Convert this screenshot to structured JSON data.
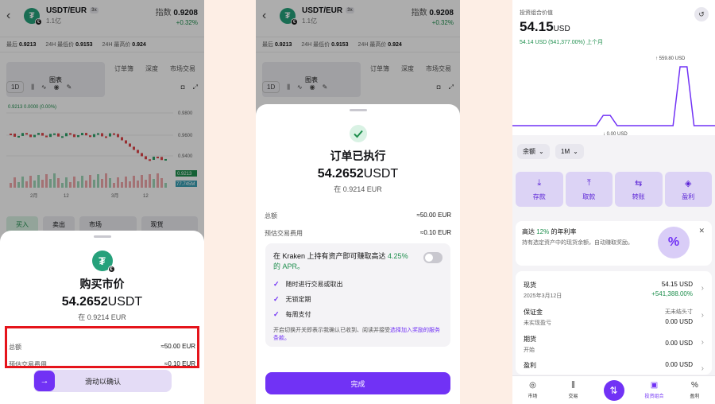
{
  "left": {
    "header": {
      "back": "‹",
      "coin_glyph": "₮",
      "pair": "USDT/EUR",
      "lev": "3x",
      "sub": "1.1亿",
      "index_label": "指数",
      "index_value": "0.9208",
      "change": "+0.32%"
    },
    "stats": {
      "last_label": "最后",
      "last_value": "0.9213",
      "low_label": "24H 最低价",
      "low_value": "0.9153",
      "high_label": "24H 最高价",
      "high_value": "0.924"
    },
    "tabs": [
      "图表",
      "订单簿",
      "深度",
      "市场交易"
    ],
    "tools": {
      "interval": "1D"
    },
    "chart": {
      "ohlc": "0.9213  0.0000 (0.00%)",
      "ticks": [
        "0.9800",
        "0.9600",
        "0.9400"
      ],
      "price_tag": "0.9213",
      "vol_tag": "77.745M",
      "xlabels": [
        "2月",
        "12",
        "3月",
        "12"
      ]
    },
    "order_bar": {
      "buy": "买入",
      "sell": "卖出",
      "type": "市场",
      "mode": "现货"
    },
    "sheet": {
      "title": "购买市价",
      "amount": "54.2652",
      "currency": "USDT",
      "at": "在 0.9214 EUR",
      "total_label": "总额",
      "total_value": "≈50.00 EUR",
      "fee_label": "预估交易费用",
      "fee_value": "≈0.10 EUR",
      "slide_label": "滑动以确认"
    }
  },
  "middle": {
    "sheet": {
      "title": "订单已执行",
      "amount": "54.2652",
      "currency": "USDT",
      "at": "在 0.9214 EUR",
      "total_label": "总额",
      "total_value": "≈50.00 EUR",
      "fee_label": "预估交易费用",
      "fee_value": "≈0.10 EUR",
      "apr_text": "在 Kraken 上持有资产即可赚取高达",
      "apr_rate": "4.25% 的 APR。",
      "bullets": [
        "随时进行交易或取出",
        "无锁定期",
        "每周支付"
      ],
      "fine_print": "开启切换开关即表示我确认已收到、阅读并接受",
      "fine_link": "选择加入奖励的服务条款。",
      "done": "完成"
    }
  },
  "right": {
    "portfolio_label": "投资组合价值",
    "portfolio_value": "54.15",
    "portfolio_currency": "USD",
    "change": "54.14 USD (541,377.00%) 上个月",
    "chart": {
      "type": "line",
      "high_label": "↑ 559.80 USD",
      "low_label": "↓ 0.00 USD",
      "values": [
        0,
        0,
        0,
        0,
        0,
        0,
        0,
        0,
        0,
        0,
        0,
        0,
        0,
        22,
        22,
        0,
        0,
        0,
        0,
        0,
        0,
        0,
        0,
        0,
        559.8,
        559.8,
        0,
        0,
        0,
        0
      ]
    },
    "filters": {
      "balance": "余额",
      "period": "1M"
    },
    "actions": [
      "存款",
      "取款",
      "转账",
      "盈利"
    ],
    "promo": {
      "title_prefix": "高达",
      "rate": "12%",
      "title_suffix": "的年利率",
      "desc": "持有选定资产中的现货余额，自动赚取奖励。",
      "art": "%"
    },
    "balances": [
      {
        "name": "现货",
        "sub": "2025年3月12日",
        "value": "54.15 USD",
        "value2": "+541,388.00%"
      },
      {
        "name": "保证金",
        "sub": "未实现盈亏",
        "value": "无未结头寸",
        "value2": "0.00 USD"
      },
      {
        "name": "期货",
        "sub": "开始",
        "value": "0.00 USD",
        "value2": ""
      },
      {
        "name": "盈利",
        "sub": "",
        "value": "0.00 USD",
        "value2": ""
      }
    ],
    "nav": [
      "市场",
      "交易",
      "",
      "投资组合",
      "盈利"
    ]
  }
}
